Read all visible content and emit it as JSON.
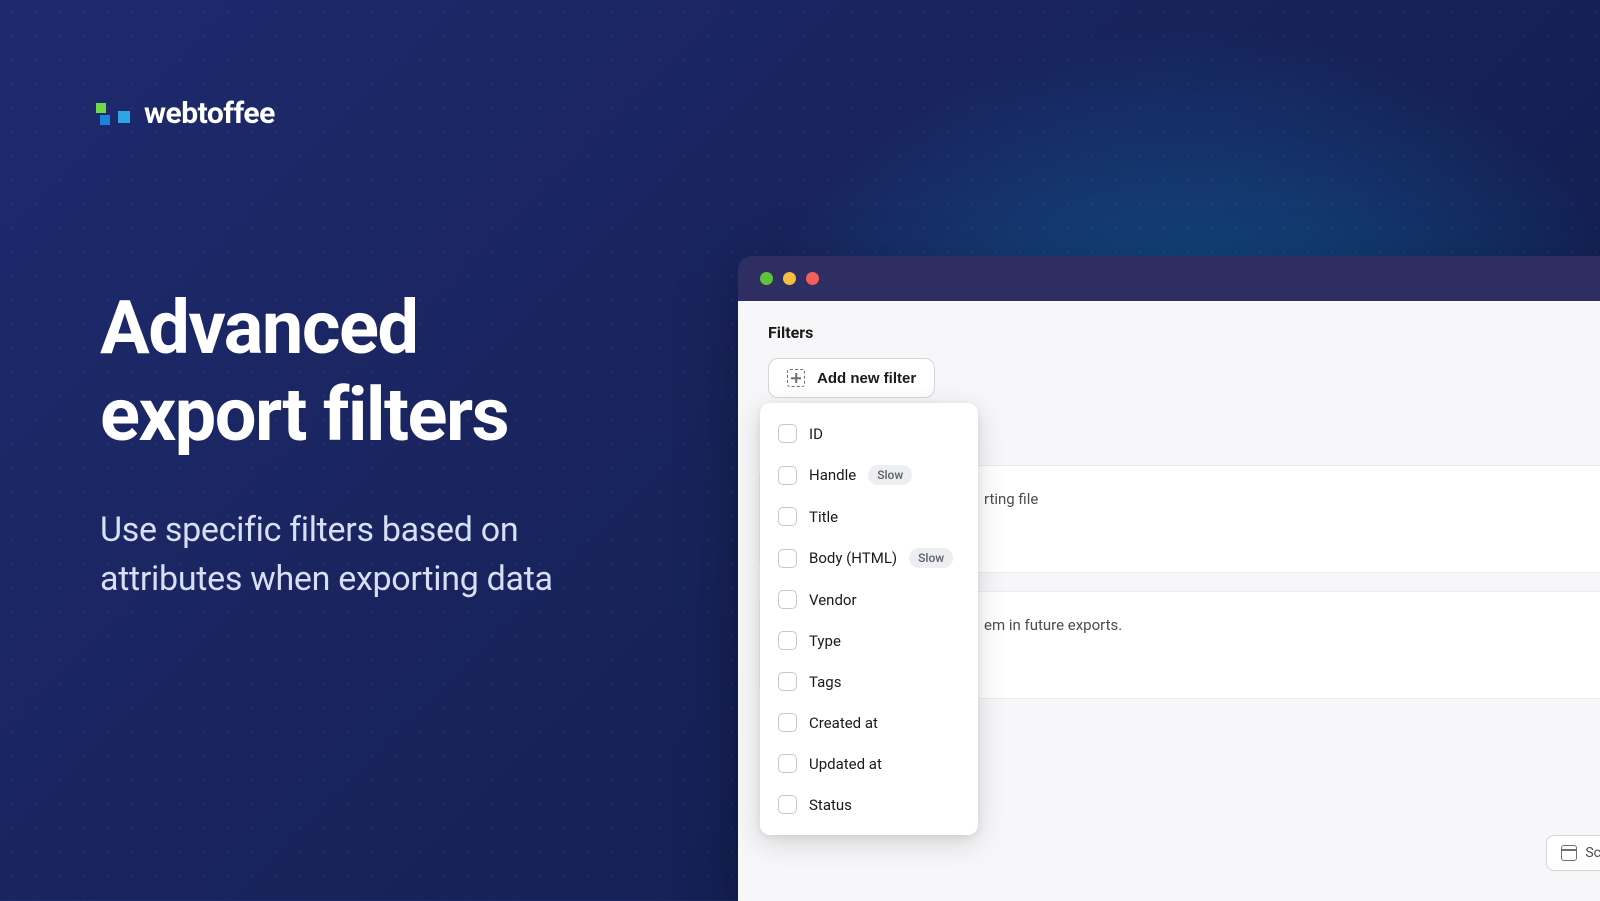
{
  "brand": {
    "name": "webtoffee"
  },
  "hero": {
    "title_line1": "Advanced",
    "title_line2": "export filters",
    "subtitle_line1": "Use specific filters based on",
    "subtitle_line2": "attributes when exporting data"
  },
  "app": {
    "section_title": "Filters",
    "add_filter_label": "Add new filter",
    "hint1_suffix": "rting file",
    "hint2_suffix": "em in future exports.",
    "schedule_label": "Sc",
    "filter_options": [
      {
        "label": "ID",
        "badge": null
      },
      {
        "label": "Handle",
        "badge": "Slow"
      },
      {
        "label": "Title",
        "badge": null
      },
      {
        "label": "Body (HTML)",
        "badge": "Slow"
      },
      {
        "label": "Vendor",
        "badge": null
      },
      {
        "label": "Type",
        "badge": null
      },
      {
        "label": "Tags",
        "badge": null
      },
      {
        "label": "Created at",
        "badge": null
      },
      {
        "label": "Updated at",
        "badge": null
      },
      {
        "label": "Status",
        "badge": null
      }
    ]
  }
}
